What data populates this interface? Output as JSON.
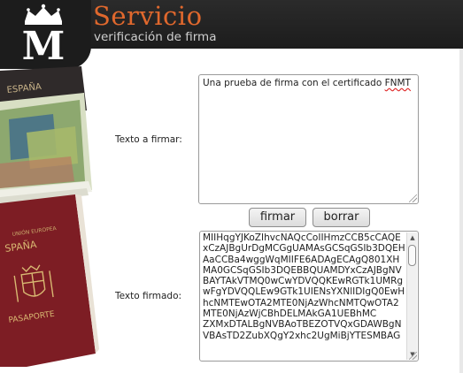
{
  "header": {
    "title": "Servicio",
    "subtitle": "verificación de firma",
    "logo_letter": "M"
  },
  "form": {
    "input_label": "Texto a firmar:",
    "input_value": "Una prueba de firma con el certificado ",
    "input_value_misspelled": "FNMT",
    "sign_button": "firmar",
    "clear_button": "borrar",
    "output_label": "Texto firmado:",
    "output_value": "MIIHqgYJKoZIhvcNAQcCoIIHmzCCB5cCAQExCzAJBgUrDgMCGgUAMAsGCSqGSIb3DQEHAaCCBa4wggWqMIIFE6ADAgECAgQ801XHMA0GCSqGSIb3DQEBBQUAMDYxCzAJBgNVBAYTAkVTMQ0wCwYDVQQKEwRGTk1UMRgwFgYDVQQLEw9GTk1UIENsYXNlIDIgQ0EwHhcNMTEwOTA2MTE0NjAzWhcNMTQwOTA2MTE0NjAzWjCBhDELMAkGA1UEBhMC\nZXMxDTALBgNVBAoTBEZOTVQxGDAWBgNVBAsTD2ZubXQgY2xhc2UgMiBjYTESMBAG"
  },
  "colors": {
    "title": "#e0682d",
    "header_bg": "#1c1c1c"
  },
  "icons": [
    "royal-mint-logo",
    "resize-grip-icon",
    "scroll-up-icon",
    "scroll-down-icon"
  ]
}
